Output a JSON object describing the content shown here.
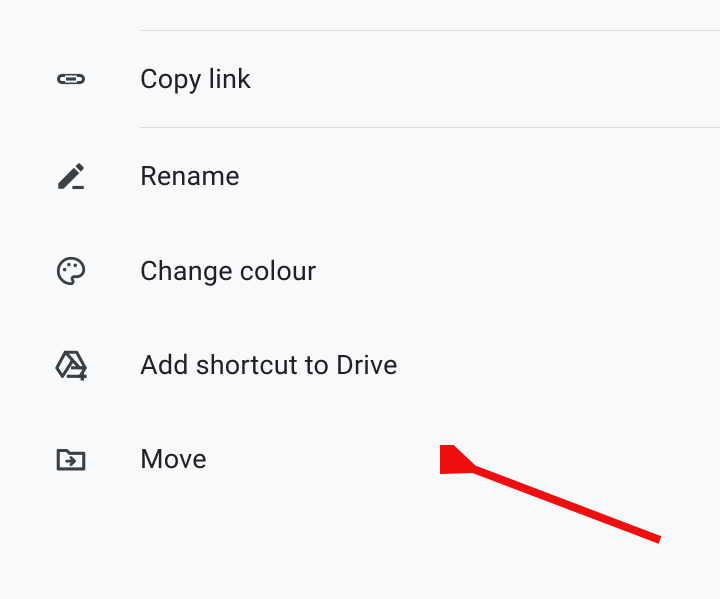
{
  "menu": {
    "items": [
      {
        "label": "Copy link"
      },
      {
        "label": "Rename"
      },
      {
        "label": "Change colour"
      },
      {
        "label": "Add shortcut to Drive"
      },
      {
        "label": "Move"
      }
    ]
  }
}
